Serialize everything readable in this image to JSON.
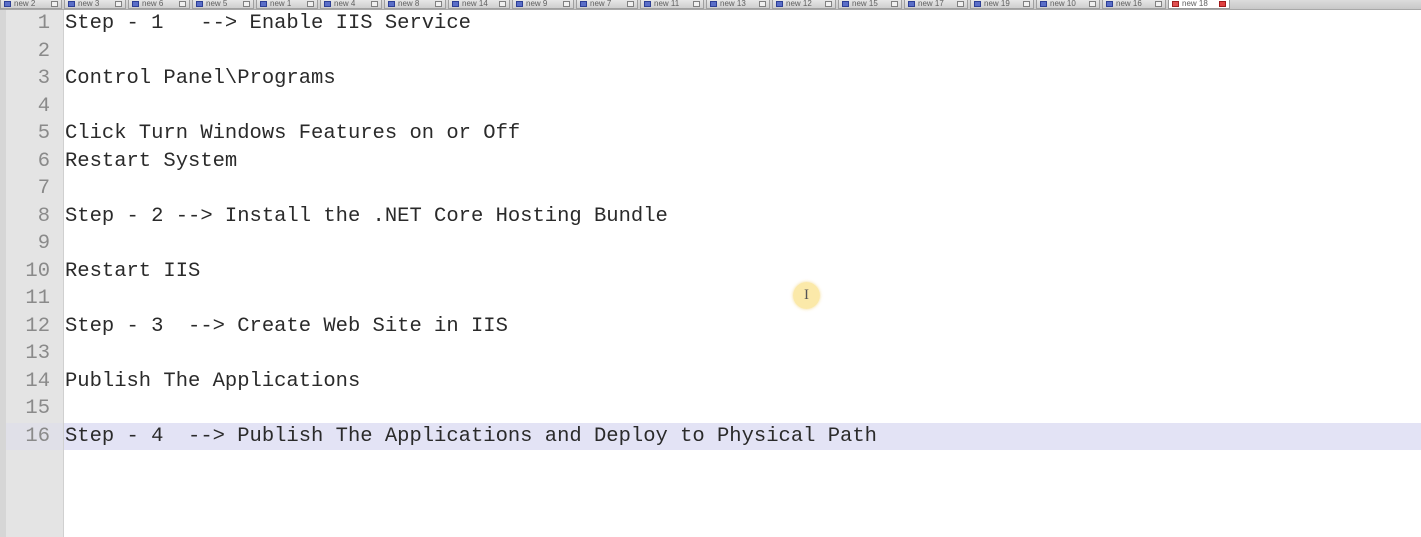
{
  "tabs": [
    {
      "label": "new 2",
      "active": false
    },
    {
      "label": "new 3",
      "active": false
    },
    {
      "label": "new 6",
      "active": false
    },
    {
      "label": "new 5",
      "active": false
    },
    {
      "label": "new 1",
      "active": false
    },
    {
      "label": "new 4",
      "active": false
    },
    {
      "label": "new 8",
      "active": false
    },
    {
      "label": "new 14",
      "active": false
    },
    {
      "label": "new 9",
      "active": false
    },
    {
      "label": "new 7",
      "active": false
    },
    {
      "label": "new 11",
      "active": false
    },
    {
      "label": "new 13",
      "active": false
    },
    {
      "label": "new 12",
      "active": false
    },
    {
      "label": "new 15",
      "active": false
    },
    {
      "label": "new 17",
      "active": false
    },
    {
      "label": "new 19",
      "active": false
    },
    {
      "label": "new 10",
      "active": false
    },
    {
      "label": "new 16",
      "active": false
    },
    {
      "label": "new 18",
      "active": true
    }
  ],
  "editor": {
    "current_line": 16,
    "lines": [
      {
        "n": "1",
        "text": "Step - 1   --> Enable IIS Service"
      },
      {
        "n": "2",
        "text": ""
      },
      {
        "n": "3",
        "text": "Control Panel\\Programs"
      },
      {
        "n": "4",
        "text": ""
      },
      {
        "n": "5",
        "text": "Click Turn Windows Features on or Off"
      },
      {
        "n": "6",
        "text": "Restart System"
      },
      {
        "n": "7",
        "text": ""
      },
      {
        "n": "8",
        "text": "Step - 2 --> Install the .NET Core Hosting Bundle"
      },
      {
        "n": "9",
        "text": ""
      },
      {
        "n": "10",
        "text": "Restart IIS"
      },
      {
        "n": "11",
        "text": ""
      },
      {
        "n": "12",
        "text": "Step - 3  --> Create Web Site in IIS"
      },
      {
        "n": "13",
        "text": ""
      },
      {
        "n": "14",
        "text": "Publish The Applications"
      },
      {
        "n": "15",
        "text": ""
      },
      {
        "n": "16",
        "text": "Step - 4  --> Publish The Applications and Deploy to Physical Path"
      }
    ]
  },
  "cursor": {
    "glyph": "I",
    "icon": "text-cursor-icon"
  }
}
